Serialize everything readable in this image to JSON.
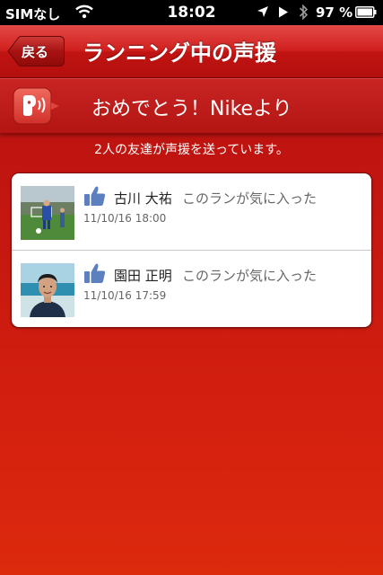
{
  "status_bar": {
    "carrier": "SIMなし",
    "time": "18:02",
    "battery": "97 %"
  },
  "nav": {
    "back_label": "戻る",
    "title": "ランニング中の声援"
  },
  "banner": {
    "text": "おめでとう！Nikeより"
  },
  "friends_count": "2人の友達が声援を送っています。",
  "cheers": [
    {
      "name": "古川 大祐",
      "message": "このランが気に入った",
      "timestamp": "11/10/16  18:00"
    },
    {
      "name": "園田 正明",
      "message": "このランが気に入った",
      "timestamp": "11/10/16  17:59"
    }
  ],
  "colors": {
    "accent": "#c8171a",
    "like": "#5b7fbf"
  },
  "icons": [
    "wifi-icon",
    "location-icon",
    "play-icon",
    "bluetooth-icon",
    "battery-icon",
    "speech-icon",
    "like-icon"
  ]
}
